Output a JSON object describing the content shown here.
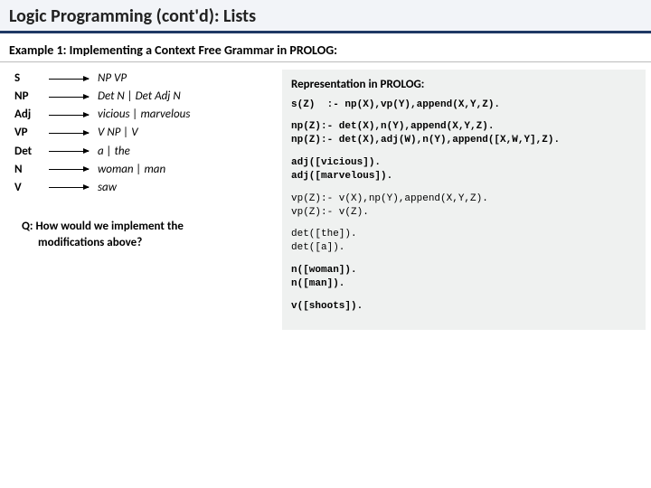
{
  "title": "Logic Programming (cont'd):   Lists",
  "example_heading": "Example 1:  Implementing a Context Free Grammar in PROLOG:",
  "grammar": [
    {
      "lhs": "S",
      "rhs": "NP VP"
    },
    {
      "lhs": "NP",
      "rhs": "Det N | Det Adj N"
    },
    {
      "lhs": "Adj",
      "rhs": "vicious | marvelous"
    },
    {
      "lhs": "VP",
      "rhs": "V NP | V"
    },
    {
      "lhs": "Det",
      "rhs": "a | the"
    },
    {
      "lhs": "N",
      "rhs": "woman | man"
    },
    {
      "lhs": "V",
      "rhs": "saw"
    }
  ],
  "question_line1": "Q: How would we implement the",
  "question_line2": "modifications above?",
  "prolog_heading": "Representation in PROLOG:",
  "code": {
    "s": "s(Z)  :- np(X),vp(Y),append(X,Y,Z).",
    "np1": "np(Z):- det(X),n(Y),append(X,Y,Z).",
    "np2": "np(Z):- det(X),adj(W),n(Y),append([X,W,Y],Z).",
    "adj1": "adj([vicious]).",
    "adj2": "adj([marvelous]).",
    "vp1": "vp(Z):- v(X),np(Y),append(X,Y,Z).",
    "vp2": "vp(Z):- v(Z).",
    "det1": "det([the]).",
    "det2": "det([a]).",
    "n1": "n([woman]).",
    "n2": "n([man]).",
    "v": "v([shoots])."
  }
}
